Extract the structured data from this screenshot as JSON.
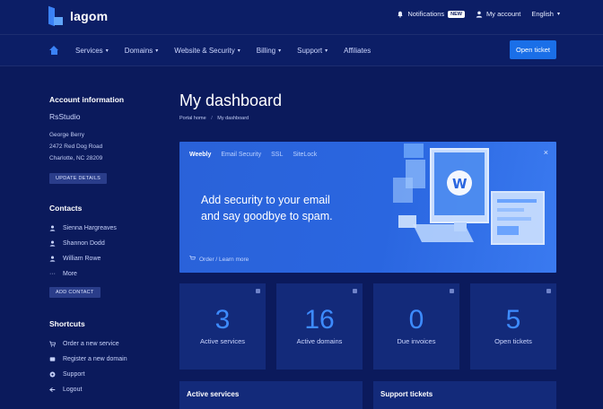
{
  "brand": {
    "name": "lagom"
  },
  "topbar": {
    "notifications": "Notifications",
    "notifications_badge": "NEW",
    "account": "My account",
    "language": "English"
  },
  "nav": {
    "items": [
      {
        "label": "Services"
      },
      {
        "label": "Domains"
      },
      {
        "label": "Website & Security"
      },
      {
        "label": "Billing"
      },
      {
        "label": "Support"
      },
      {
        "label": "Affiliates"
      }
    ],
    "open_ticket": "Open ticket"
  },
  "sidebar": {
    "account_heading": "Account information",
    "org": "RsStudio",
    "name": "George Berry",
    "address1": "2472 Red Dog Road",
    "address2": "Charlotte, NC 28209",
    "update_btn": "UPDATE DETAILS",
    "contacts_heading": "Contacts",
    "contacts": [
      {
        "label": "Sienna Hargreaves"
      },
      {
        "label": "Shannon Dodd"
      },
      {
        "label": "William Rowe"
      },
      {
        "label": "More"
      }
    ],
    "add_contact_btn": "ADD CONTACT",
    "shortcuts_heading": "Shortcuts",
    "shortcuts": [
      {
        "label": "Order a new service"
      },
      {
        "label": "Register a new domain"
      },
      {
        "label": "Support"
      },
      {
        "label": "Logout"
      }
    ]
  },
  "main": {
    "title": "My dashboard",
    "breadcrumb": {
      "home": "Portal home",
      "current": "My dashboard"
    },
    "banner": {
      "tabs": [
        {
          "label": "Weebly"
        },
        {
          "label": "Email Security"
        },
        {
          "label": "SSL"
        },
        {
          "label": "SiteLock"
        }
      ],
      "headline_line1": "Add security to your email",
      "headline_line2": "and say goodbye to spam.",
      "footer": "Order / Learn more",
      "close": "×"
    },
    "stats": [
      {
        "value": "3",
        "label": "Active services"
      },
      {
        "value": "16",
        "label": "Active domains"
      },
      {
        "value": "0",
        "label": "Due invoices"
      },
      {
        "value": "5",
        "label": "Open tickets"
      }
    ],
    "panels": [
      {
        "title": "Active services"
      },
      {
        "title": "Support tickets"
      }
    ]
  },
  "colors": {
    "background": "#0b1a5c",
    "accent": "#1a6fe8",
    "stat_number": "#3d8bff",
    "card": "#132a7a"
  }
}
